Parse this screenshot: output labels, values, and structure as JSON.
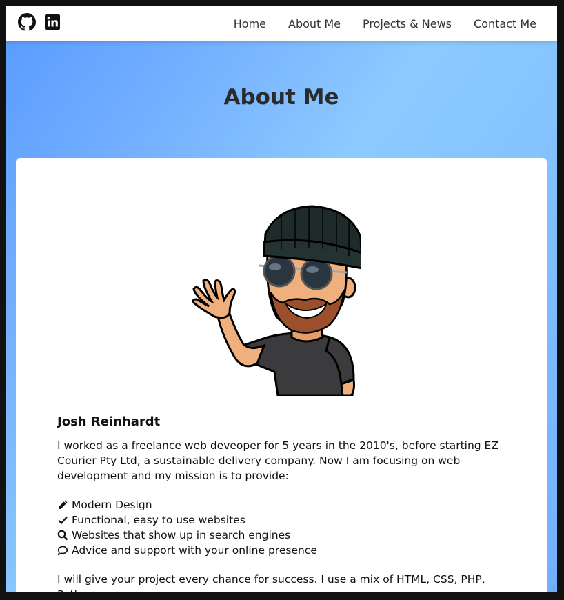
{
  "nav": {
    "social": [
      {
        "name": "github",
        "icon": "github-icon"
      },
      {
        "name": "linkedin",
        "icon": "linkedin-icon"
      }
    ],
    "links": [
      "Home",
      "About Me",
      "Projects & News",
      "Contact Me"
    ]
  },
  "page": {
    "title": "About Me"
  },
  "card": {
    "avatar_icon": "cartoon-avatar-waving",
    "name": "Josh Reinhardt",
    "intro": "I worked as a freelance web deveoper for 5 years in the 2010's, before starting EZ Courier Pty Ltd, a sustainable delivery company. Now I am focusing on web development and my mission is to provide:",
    "features": [
      {
        "icon": "pencil-icon",
        "label": "Modern Design"
      },
      {
        "icon": "check-icon",
        "label": "Functional, easy to use websites"
      },
      {
        "icon": "search-icon",
        "label": "Websites that show up in search engines"
      },
      {
        "icon": "comment-icon",
        "label": "Advice and support with your online presence"
      }
    ],
    "outro": "I will give your project every chance for success. I use a mix of HTML, CSS, PHP, Python,"
  },
  "colors": {
    "hero_start": "#5b9dff",
    "hero_mid": "#8ccaff",
    "title": "#2b2b2b",
    "nav_bg": "#ffffff"
  }
}
